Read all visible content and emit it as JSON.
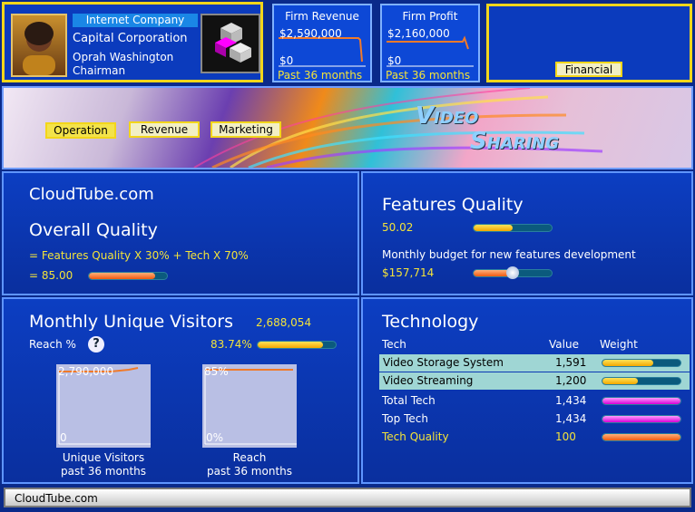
{
  "header": {
    "company_type": "Internet Company",
    "company_name": "Capital Corporation",
    "chairman_name": "Oprah Washington",
    "chairman_title": "Chairman",
    "revenue": {
      "title": "Firm Revenue",
      "top": "$2,590,000",
      "bottom": "$0",
      "period": "Past 36 months"
    },
    "profit": {
      "title": "Firm Profit",
      "top": "$2,160,000",
      "bottom": "$0",
      "period": "Past 36 months"
    },
    "financial_button": "Financial"
  },
  "banner": {
    "tabs": [
      "Operation",
      "Revenue",
      "Marketing"
    ],
    "title_line1": "Video",
    "title_line2": "Sharing"
  },
  "overall": {
    "site_name": "CloudTube.com",
    "title": "Overall  Quality",
    "formula": "= Features Quality X 30% + Tech X 70%",
    "value": "= 85.00",
    "fill": 0.85
  },
  "features": {
    "title": "Features  Quality",
    "value": "50.02",
    "fill": 0.5,
    "budget_label": "Monthly budget for new features development",
    "budget_value": "$157,714",
    "budget_fill": 0.47
  },
  "visitors": {
    "title": "Monthly  Unique  Visitors",
    "count": "2,688,054",
    "reach_label": "Reach %",
    "reach_value": "83.74%",
    "reach_fill": 0.84,
    "help_icon": "?",
    "chart1": {
      "top": "2,790,000",
      "bottom": "0",
      "caption1": "Unique Visitors",
      "caption2": "past 36 months"
    },
    "chart2": {
      "top": "85%",
      "bottom": "0%",
      "caption1": "Reach",
      "caption2": "past 36 months"
    }
  },
  "technology": {
    "title": "Technology",
    "col_tech": "Tech",
    "col_value": "Value",
    "col_weight": "Weight",
    "rows": [
      {
        "name": "Video Storage System",
        "value": "1,591",
        "fill": 0.65,
        "color": "yellow"
      },
      {
        "name": "Video Streaming",
        "value": "1,200",
        "fill": 0.45,
        "color": "yellow"
      }
    ],
    "totals": [
      {
        "name": "Total Tech",
        "value": "1,434",
        "fill": 1.0,
        "color": "magenta"
      },
      {
        "name": "Top Tech",
        "value": "1,434",
        "fill": 1.0,
        "color": "magenta"
      },
      {
        "name": "Tech Quality",
        "value": "100",
        "fill": 1.0,
        "color": "orange"
      }
    ]
  },
  "status_bar": {
    "text": "CloudTube.com"
  },
  "colors": {
    "accent_yellow": "#f3d61a",
    "panel_blue": "#0c3ec2",
    "highlight_row": "#9fd6d4"
  }
}
